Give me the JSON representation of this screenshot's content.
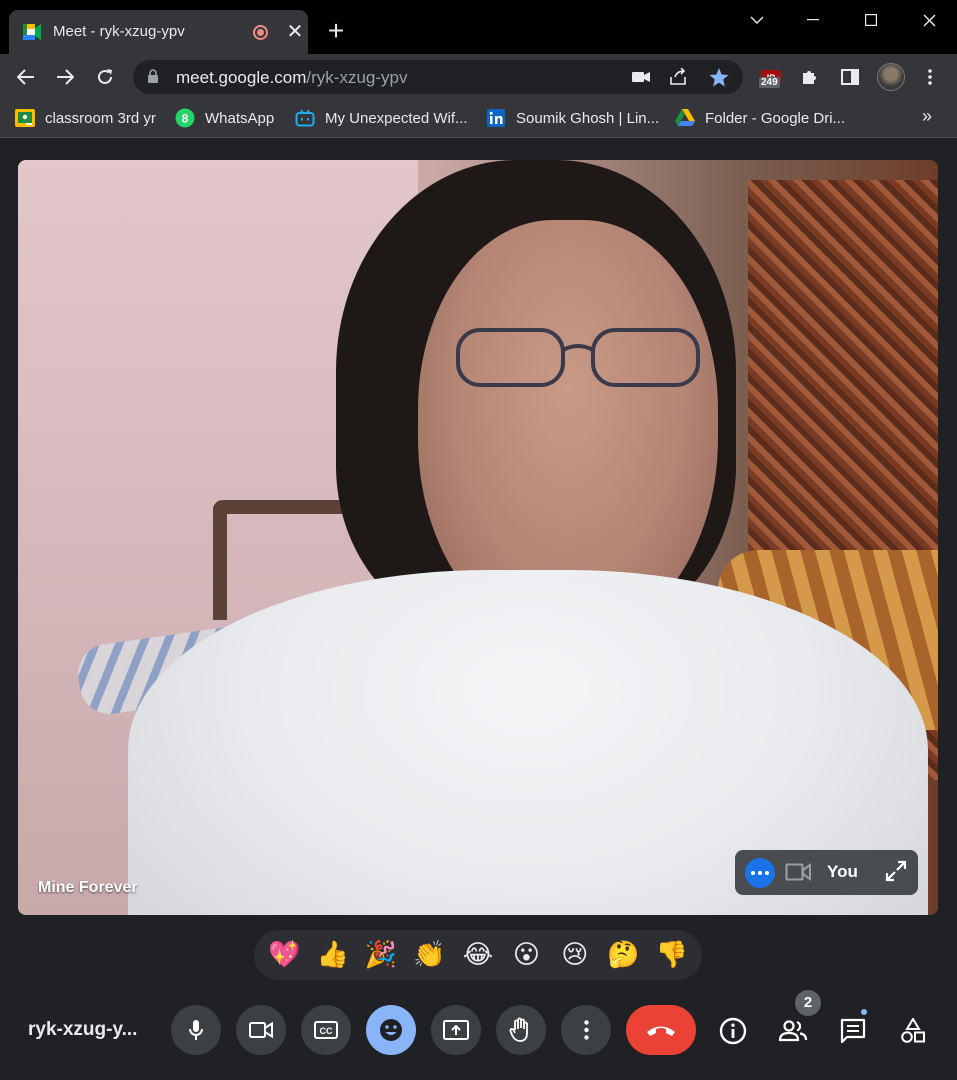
{
  "browser": {
    "tab": {
      "title": "Meet - ryk-xzug-ypv"
    },
    "omnibox": {
      "host": "meet.google.com",
      "path": "/ryk-xzug-ypv"
    },
    "extension_badge": "249",
    "bookmarks": [
      {
        "label": "classroom 3rd yr",
        "icon": "google-classroom-icon"
      },
      {
        "label": "WhatsApp",
        "icon": "whatsapp-icon"
      },
      {
        "label": "My Unexpected Wif...",
        "icon": "bilibili-icon"
      },
      {
        "label": "Soumik Ghosh | Lin...",
        "icon": "linkedin-icon"
      },
      {
        "label": "Folder - Google Dri...",
        "icon": "google-drive-icon"
      }
    ],
    "bookmarks_overflow": "»"
  },
  "meet": {
    "participant_name": "Mine Forever",
    "self_view_label": "You",
    "meeting_code": "ryk-xzug-y...",
    "people_count": "2",
    "reactions": [
      "💖",
      "👍",
      "🎉",
      "👏",
      "😂",
      "😮",
      "😢",
      "🤔",
      "👎"
    ]
  },
  "colors": {
    "accent_blue": "#8ab4f8",
    "self_more_blue": "#1a73e8",
    "hangup_red": "#ea4335",
    "bg_dark": "#202124"
  }
}
